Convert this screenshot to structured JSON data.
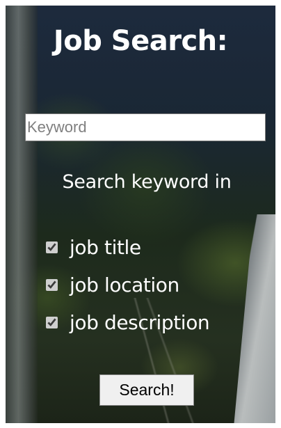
{
  "form": {
    "title": "Job Search:",
    "keyword_placeholder": "Keyword",
    "keyword_value": "",
    "search_in_label": "Search keyword in",
    "options": [
      {
        "label": "job title",
        "checked": true
      },
      {
        "label": "job location",
        "checked": true
      },
      {
        "label": "job description",
        "checked": true
      }
    ],
    "submit_label": "Search!"
  }
}
